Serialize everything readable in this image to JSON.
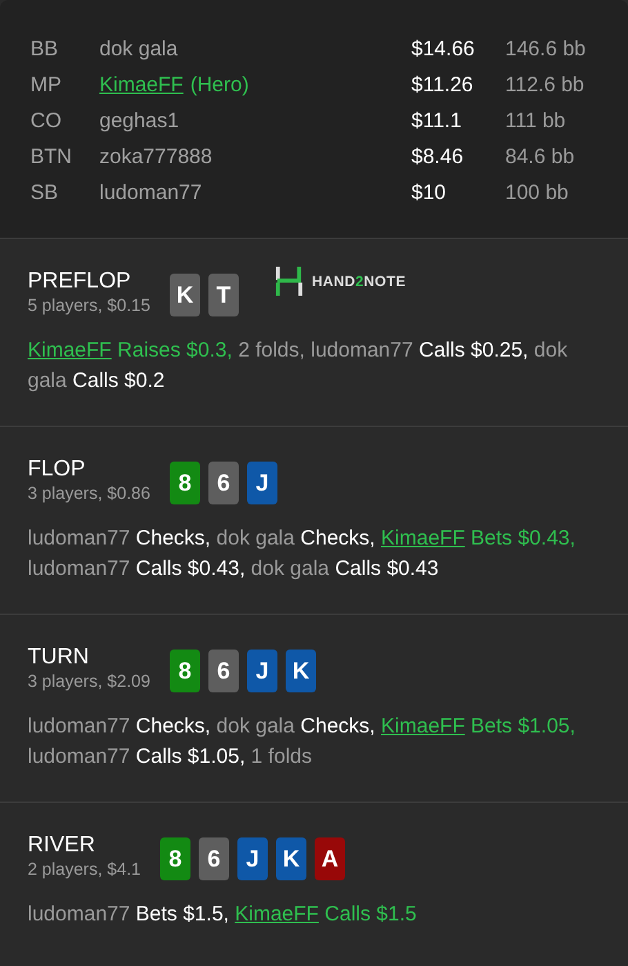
{
  "players": [
    {
      "position": "BB",
      "name": "dok gala",
      "hero": false,
      "stack": "$14.66",
      "bb": "146.6 bb"
    },
    {
      "position": "MP",
      "name": "KimaeFF",
      "hero": true,
      "hero_label": "(Hero)",
      "stack": "$11.26",
      "bb": "112.6 bb"
    },
    {
      "position": "CO",
      "name": "geghas1",
      "hero": false,
      "stack": "$11.1",
      "bb": "111 bb"
    },
    {
      "position": "BTN",
      "name": "zoka777888",
      "hero": false,
      "stack": "$8.46",
      "bb": "84.6 bb"
    },
    {
      "position": "SB",
      "name": "ludoman77",
      "hero": false,
      "stack": "$10",
      "bb": "100 bb"
    }
  ],
  "streets": [
    {
      "title": "PREFLOP",
      "summary": "5 players, $0.15",
      "cards": [
        {
          "rank": "K",
          "color": "#5e5e5e"
        },
        {
          "rank": "T",
          "color": "#5e5e5e"
        }
      ],
      "logo_parts": [
        "HAND",
        "2",
        "NOTE"
      ],
      "actions": [
        {
          "kind": "hero",
          "text": "KimaeFF"
        },
        {
          "kind": "hero_action",
          "text": "Raises $0.3,"
        },
        {
          "kind": "player",
          "text": "2 folds, ludoman77"
        },
        {
          "kind": "action",
          "text": "Calls $0.25,"
        },
        {
          "kind": "player",
          "text": "dok gala"
        },
        {
          "kind": "action",
          "text": "Calls $0.2"
        }
      ]
    },
    {
      "title": "FLOP",
      "summary": "3 players, $0.86",
      "cards": [
        {
          "rank": "8",
          "color": "#138a13"
        },
        {
          "rank": "6",
          "color": "#5e5e5e"
        },
        {
          "rank": "J",
          "color": "#0f58a8"
        }
      ],
      "actions": [
        {
          "kind": "player",
          "text": "ludoman77"
        },
        {
          "kind": "action",
          "text": "Checks,"
        },
        {
          "kind": "player",
          "text": "dok gala"
        },
        {
          "kind": "action",
          "text": "Checks,"
        },
        {
          "kind": "hero",
          "text": "KimaeFF"
        },
        {
          "kind": "hero_action",
          "text": "Bets $0.43,"
        },
        {
          "kind": "player",
          "text": "ludoman77"
        },
        {
          "kind": "action",
          "text": "Calls $0.43,"
        },
        {
          "kind": "player",
          "text": "dok gala"
        },
        {
          "kind": "action",
          "text": "Calls $0.43"
        }
      ]
    },
    {
      "title": "TURN",
      "summary": "3 players, $2.09",
      "cards": [
        {
          "rank": "8",
          "color": "#138a13"
        },
        {
          "rank": "6",
          "color": "#5e5e5e"
        },
        {
          "rank": "J",
          "color": "#0f58a8"
        },
        {
          "rank": "K",
          "color": "#0f58a8"
        }
      ],
      "actions": [
        {
          "kind": "player",
          "text": "ludoman77"
        },
        {
          "kind": "action",
          "text": "Checks,"
        },
        {
          "kind": "player",
          "text": "dok gala"
        },
        {
          "kind": "action",
          "text": "Checks,"
        },
        {
          "kind": "hero",
          "text": "KimaeFF"
        },
        {
          "kind": "hero_action",
          "text": "Bets $1.05,"
        },
        {
          "kind": "player",
          "text": "ludoman77"
        },
        {
          "kind": "action",
          "text": "Calls $1.05,"
        },
        {
          "kind": "player",
          "text": "1 folds"
        }
      ]
    },
    {
      "title": "RIVER",
      "summary": "2 players, $4.1",
      "cards": [
        {
          "rank": "8",
          "color": "#138a13"
        },
        {
          "rank": "6",
          "color": "#5e5e5e"
        },
        {
          "rank": "J",
          "color": "#0f58a8"
        },
        {
          "rank": "K",
          "color": "#0f58a8"
        },
        {
          "rank": "A",
          "color": "#980808"
        }
      ],
      "actions": [
        {
          "kind": "player",
          "text": "ludoman77"
        },
        {
          "kind": "action",
          "text": "Bets $1.5,"
        },
        {
          "kind": "hero",
          "text": "KimaeFF"
        },
        {
          "kind": "hero_action",
          "text": "Calls $1.5"
        }
      ]
    }
  ]
}
